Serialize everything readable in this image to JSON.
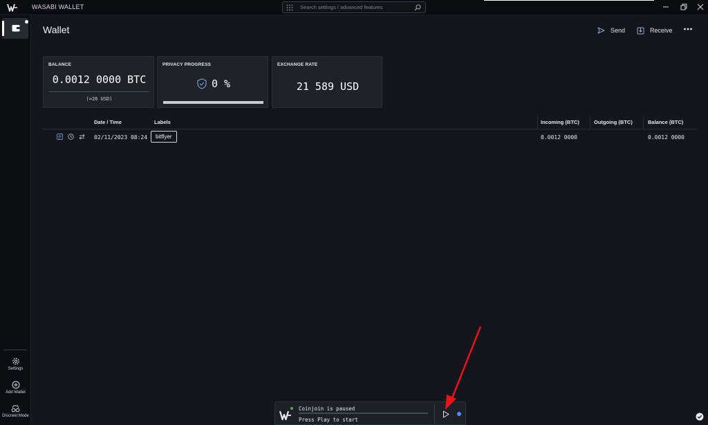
{
  "window": {
    "title": "WASABI WALLET",
    "search_placeholder": "Search settings / advanced features"
  },
  "sidebar": {
    "items": [
      {
        "label": "Settings"
      },
      {
        "label": "Add Wallet"
      },
      {
        "label": "Discreet Mode"
      }
    ]
  },
  "page": {
    "title": "Wallet",
    "send_label": "Send",
    "receive_label": "Receive",
    "more_icon": "ellipsis-icon"
  },
  "tiles": {
    "balance": {
      "label": "BALANCE",
      "value": "0.0012 0000 BTC",
      "sub": "(≈26 USD)"
    },
    "privacy": {
      "label": "PRIVACY PROGRESS",
      "value": "0 %",
      "progress": 1.0
    },
    "rate": {
      "label": "EXCHANGE RATE",
      "value": "21 589 USD"
    }
  },
  "table": {
    "headers": [
      "Date / Time",
      "Labels",
      "Incoming (BTC)",
      "Outgoing (BTC)",
      "Balance (BTC)"
    ],
    "rows": [
      {
        "date": "02/11/2023 08:24",
        "label": "bitflyer",
        "incoming": "0.0012 0000",
        "outgoing": "",
        "balance": "0.0012 0000"
      }
    ]
  },
  "coinjoin": {
    "status": "Coinjoin is paused",
    "hint": "Press Play to start"
  },
  "colors": {
    "background": "#14161b",
    "rail": "#0d0e12",
    "tile": "#1f2228",
    "accent_blue": "#4f8ef7",
    "annotation_red": "#e8141b"
  }
}
